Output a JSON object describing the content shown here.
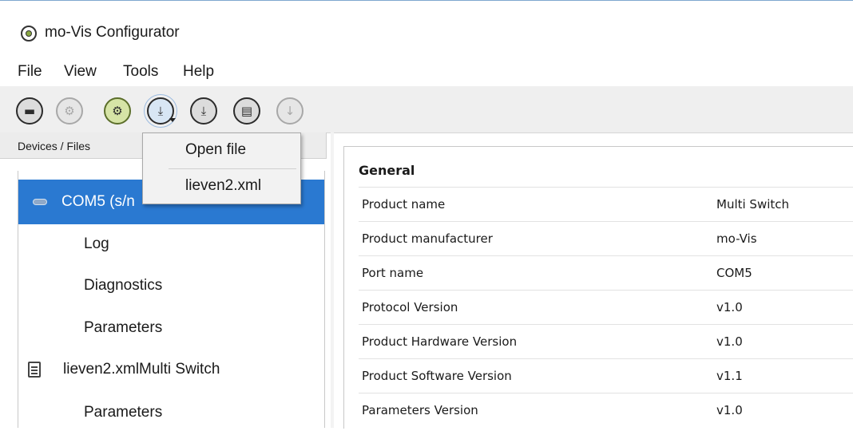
{
  "window": {
    "title": "mo-Vis Configurator",
    "icon": "gear-icon"
  },
  "menubar": {
    "items": [
      "File",
      "View",
      "Tools",
      "Help"
    ]
  },
  "toolbar": {
    "buttons": [
      {
        "icon": "folder-open-icon",
        "glyph": "▬",
        "state": "enabled"
      },
      {
        "icon": "firmware-icon",
        "glyph": "⚙",
        "state": "disabled"
      },
      {
        "icon": "gears-icon",
        "glyph": "⚙",
        "state": "active"
      },
      {
        "icon": "download-menu-icon",
        "glyph": "⤓",
        "state": "pressed"
      },
      {
        "icon": "download-filter-icon",
        "glyph": "⤓",
        "state": "enabled"
      },
      {
        "icon": "document-icon",
        "glyph": "▤",
        "state": "enabled"
      },
      {
        "icon": "arrow-down-icon",
        "glyph": "↓",
        "state": "disabled"
      }
    ]
  },
  "left_panel": {
    "header": "Devices / Files",
    "tree": [
      {
        "label": "COM5 (s/n",
        "icon": "connection-icon",
        "selected": true
      },
      {
        "label": "Log"
      },
      {
        "label": "Diagnostics"
      },
      {
        "label": "Parameters"
      },
      {
        "label": "lieven2.xmlMulti Switch",
        "icon": "file-icon"
      },
      {
        "label": "Parameters"
      }
    ]
  },
  "dropdown": {
    "items": [
      "Open file",
      "lieven2.xml"
    ]
  },
  "details": {
    "section": "General",
    "rows": [
      {
        "name": "Product name",
        "value": "Multi Switch"
      },
      {
        "name": "Product manufacturer",
        "value": "mo-Vis"
      },
      {
        "name": "Port name",
        "value": "COM5"
      },
      {
        "name": "Protocol Version",
        "value": "v1.0"
      },
      {
        "name": "Product Hardware Version",
        "value": "v1.0"
      },
      {
        "name": "Product Software Version",
        "value": "v1.1"
      },
      {
        "name": "Parameters Version",
        "value": "v1.0"
      }
    ]
  },
  "colors": {
    "selection": "#2a79d1",
    "active_button": "#d6e4a6"
  }
}
